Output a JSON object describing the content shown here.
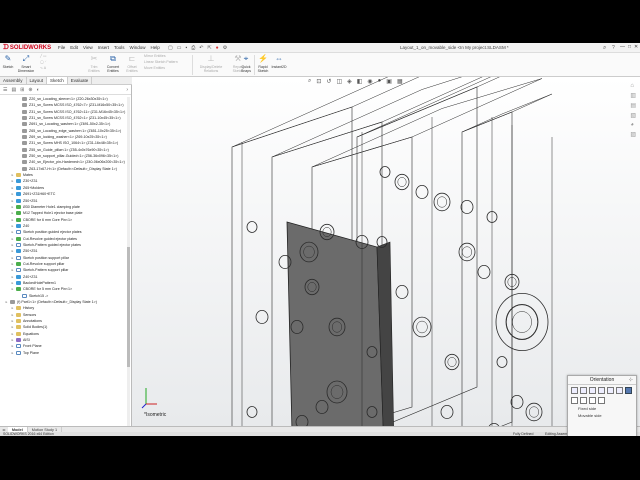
{
  "app": {
    "logo": "SOLIDWORKS",
    "menus": [
      "File",
      "Edit",
      "View",
      "Insert",
      "Tools",
      "Window",
      "Help"
    ],
    "document_title": "Layout_1_on_movable_side <In My project.SLDASM *",
    "window_controls": [
      "—",
      "□",
      "✕"
    ]
  },
  "toolbar": {
    "sketch": "Sketch",
    "smart_dimension": "Smart Dimension",
    "trim_entities": "Trim Entities",
    "convert_entities": "Convert Entities",
    "offset_entities": "Offset Entities",
    "mirror_entities": "Mirror Entities",
    "linear_pattern": "Linear Sketch Pattern",
    "move_entities": "Move Entities",
    "display_delete": "Display/Delete Relations",
    "repair_sketch": "Repair Sketch",
    "quick_snaps": "Quick Snaps",
    "rapid_sketch": "Rapid Sketch",
    "instant2d": "Instant2D"
  },
  "tabs": [
    "Assembly",
    "Layout",
    "Sketch",
    "Evaluate"
  ],
  "active_tab": "Sketch",
  "tree": [
    {
      "level": 2,
      "icon": "part",
      "label": "Z20_sn_Locating_sleeve<1> (Z20-26x30x35<1>)"
    },
    {
      "level": 2,
      "icon": "part",
      "label": "Z31_sn_Screw MCSS ISO_4762<7> (Z31-M16x50<35<1>)"
    },
    {
      "level": 2,
      "icon": "part",
      "label": "Z31_sn_Screw MCSS ISO_4762<11> (Z31-M16x45<35<1>)"
    },
    {
      "level": 2,
      "icon": "part",
      "label": "Z31_sn_Screw MCSS ISO_4762<1> (Z31-10x45<35<1>)"
    },
    {
      "level": 2,
      "icon": "part",
      "label": "Z691_sn_Locating_washer<1> (Z691-50x2-35<1>)"
    },
    {
      "level": 2,
      "icon": "part",
      "label": "Z65_sn_Locating_edge_washer<1> (Z651-10x25<35<1>)"
    },
    {
      "level": 2,
      "icon": "part",
      "label": "Z69_sn_locking_washer<1> (Z69-10x25<35<1>)"
    },
    {
      "level": 2,
      "icon": "part",
      "label": "Z31_sn_Screw MHS ISO_1064<1> (Z31-16x48<35<1>)"
    },
    {
      "level": 2,
      "icon": "part",
      "label": "Z55_sn_Guide_pillar<1> (Z55-4x0x76x90<35<1>)"
    },
    {
      "level": 2,
      "icon": "part",
      "label": "Z50_sn_support_pillar-Guided<1> (Z56-36x096<35<1>)"
    },
    {
      "level": 2,
      "icon": "part",
      "label": "Z40_sn_Ejector_pin-Hardened<1> (Z40-06x06x200<35<1>)"
    },
    {
      "level": 2,
      "icon": "part",
      "label": "Z63-17x67-H<1> (Default<<Default>_Display State 1>)"
    },
    {
      "level": 1,
      "icon": "folder",
      "label": "Mates"
    },
    {
      "level": 1,
      "icon": "feat",
      "label": "Z30+Z31"
    },
    {
      "level": 1,
      "icon": "feat",
      "label": "Z65+Molders"
    },
    {
      "level": 1,
      "icon": "feat",
      "label": "Z691+Z31H60+ETC"
    },
    {
      "level": 1,
      "icon": "feat",
      "label": "Z50+Z51"
    },
    {
      "level": 1,
      "icon": "cut",
      "label": "Ø30 Diameter Hole1 clamping plate"
    },
    {
      "level": 1,
      "icon": "cut",
      "label": "M12 Tapped Hole1 ejector base plate"
    },
    {
      "level": 1,
      "icon": "cut",
      "label": "CBORE for 6 mm Core Pin<1>"
    },
    {
      "level": 1,
      "icon": "feat",
      "label": "Z40"
    },
    {
      "level": 1,
      "icon": "sketch",
      "label": "Sketch position guided ejector plates"
    },
    {
      "level": 1,
      "icon": "cut",
      "label": "Cut-Revolve guided ejector plates"
    },
    {
      "level": 1,
      "icon": "sketch",
      "label": "Sketch-Pattern guided ejector plates"
    },
    {
      "level": 1,
      "icon": "feat",
      "label": "Z50+Z51"
    },
    {
      "level": 1,
      "icon": "sketch",
      "label": "Sketch position support pillar"
    },
    {
      "level": 1,
      "icon": "cut",
      "label": "Cut-Revolve support pillar"
    },
    {
      "level": 1,
      "icon": "sketch",
      "label": "Sketch-Pattern support pillar"
    },
    {
      "level": 1,
      "icon": "feat",
      "label": "Z40+Z31"
    },
    {
      "level": 1,
      "icon": "feat",
      "label": "BackedHolePattern1"
    },
    {
      "level": 1,
      "icon": "cut",
      "label": "CBORE for 5 mm Core Pin<1>"
    },
    {
      "level": 2,
      "icon": "sketch",
      "label": "Sketch15 ->"
    },
    {
      "level": 0,
      "icon": "part",
      "label": "(f) Part1<1> (Default<<Default>_Display State 1>)"
    },
    {
      "level": 1,
      "icon": "folder",
      "label": "History"
    },
    {
      "level": 1,
      "icon": "folder",
      "label": "Sensors"
    },
    {
      "level": 1,
      "icon": "folder",
      "label": "Annotations"
    },
    {
      "level": 1,
      "icon": "folder",
      "label": "Solid Bodies(1)"
    },
    {
      "level": 1,
      "icon": "folder",
      "label": "Equations"
    },
    {
      "level": 1,
      "icon": "mate",
      "label": "AISI"
    },
    {
      "level": 1,
      "icon": "sketch",
      "label": "Front Plane"
    },
    {
      "level": 1,
      "icon": "sketch",
      "label": "Top Plane"
    }
  ],
  "viewport": {
    "view_label": "*Isometric"
  },
  "orientation": {
    "title": "Orientation",
    "options": [
      "Fixed side",
      "Movable side"
    ]
  },
  "bottom_tabs": [
    "Model",
    "Motion Study 1"
  ],
  "status": {
    "left": "SOLIDWORKS 2016 x64 Edition",
    "definition": "Fully Defined",
    "editing": "Editing Assembly",
    "units": "Custom"
  }
}
